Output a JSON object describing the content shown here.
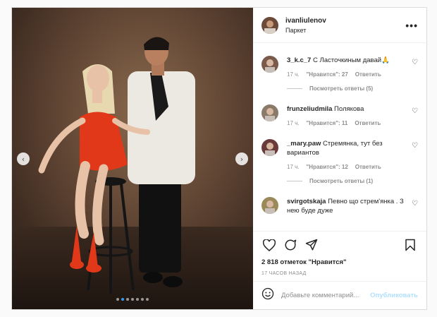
{
  "header": {
    "username": "ivanliulenov",
    "location": "Паркет",
    "more_icon": "more-horizontal-icon"
  },
  "media": {
    "prev_glyph": "‹",
    "next_glyph": "›",
    "slide_count": 7,
    "active_slide": 2
  },
  "comments": [
    {
      "user": "3_k.c_7",
      "text": "С Ласточкиным давай🙏",
      "time": "17 ч.",
      "likes": "\"Нравится\": 27",
      "reply": "Ответить",
      "view_replies": "Посмотреть ответы (5)",
      "avatar_color": "#7a5a4a"
    },
    {
      "user": "frunzeliudmila",
      "text": "Полякова",
      "time": "17 ч.",
      "likes": "\"Нравится\": 11",
      "reply": "Ответить",
      "view_replies": "",
      "avatar_color": "#8a7a6a"
    },
    {
      "user": "_mary.paw",
      "text": "Стремянка, тут без вариантов",
      "time": "17 ч.",
      "likes": "\"Нравится\": 12",
      "reply": "Ответить",
      "view_replies": "Посмотреть ответы (1)",
      "avatar_color": "#6b3a3a"
    },
    {
      "user": "svirgotskaja",
      "text": "Певно що стрем'янка . З нею буде дуже",
      "time": "",
      "likes": "",
      "reply": "",
      "view_replies": "",
      "avatar_color": "#9a8a5a"
    }
  ],
  "actions": {
    "like_icon": "heart-icon",
    "comment_icon": "comment-icon",
    "share_icon": "share-icon",
    "save_icon": "bookmark-icon",
    "likes_text": "2 818 отметок \"Нравится\"",
    "time_ago": "17 ЧАСОВ НАЗАД"
  },
  "add_comment": {
    "placeholder": "Добавьте комментарий...",
    "publish": "Опубликовать",
    "emoji_icon": "emoji-icon"
  }
}
